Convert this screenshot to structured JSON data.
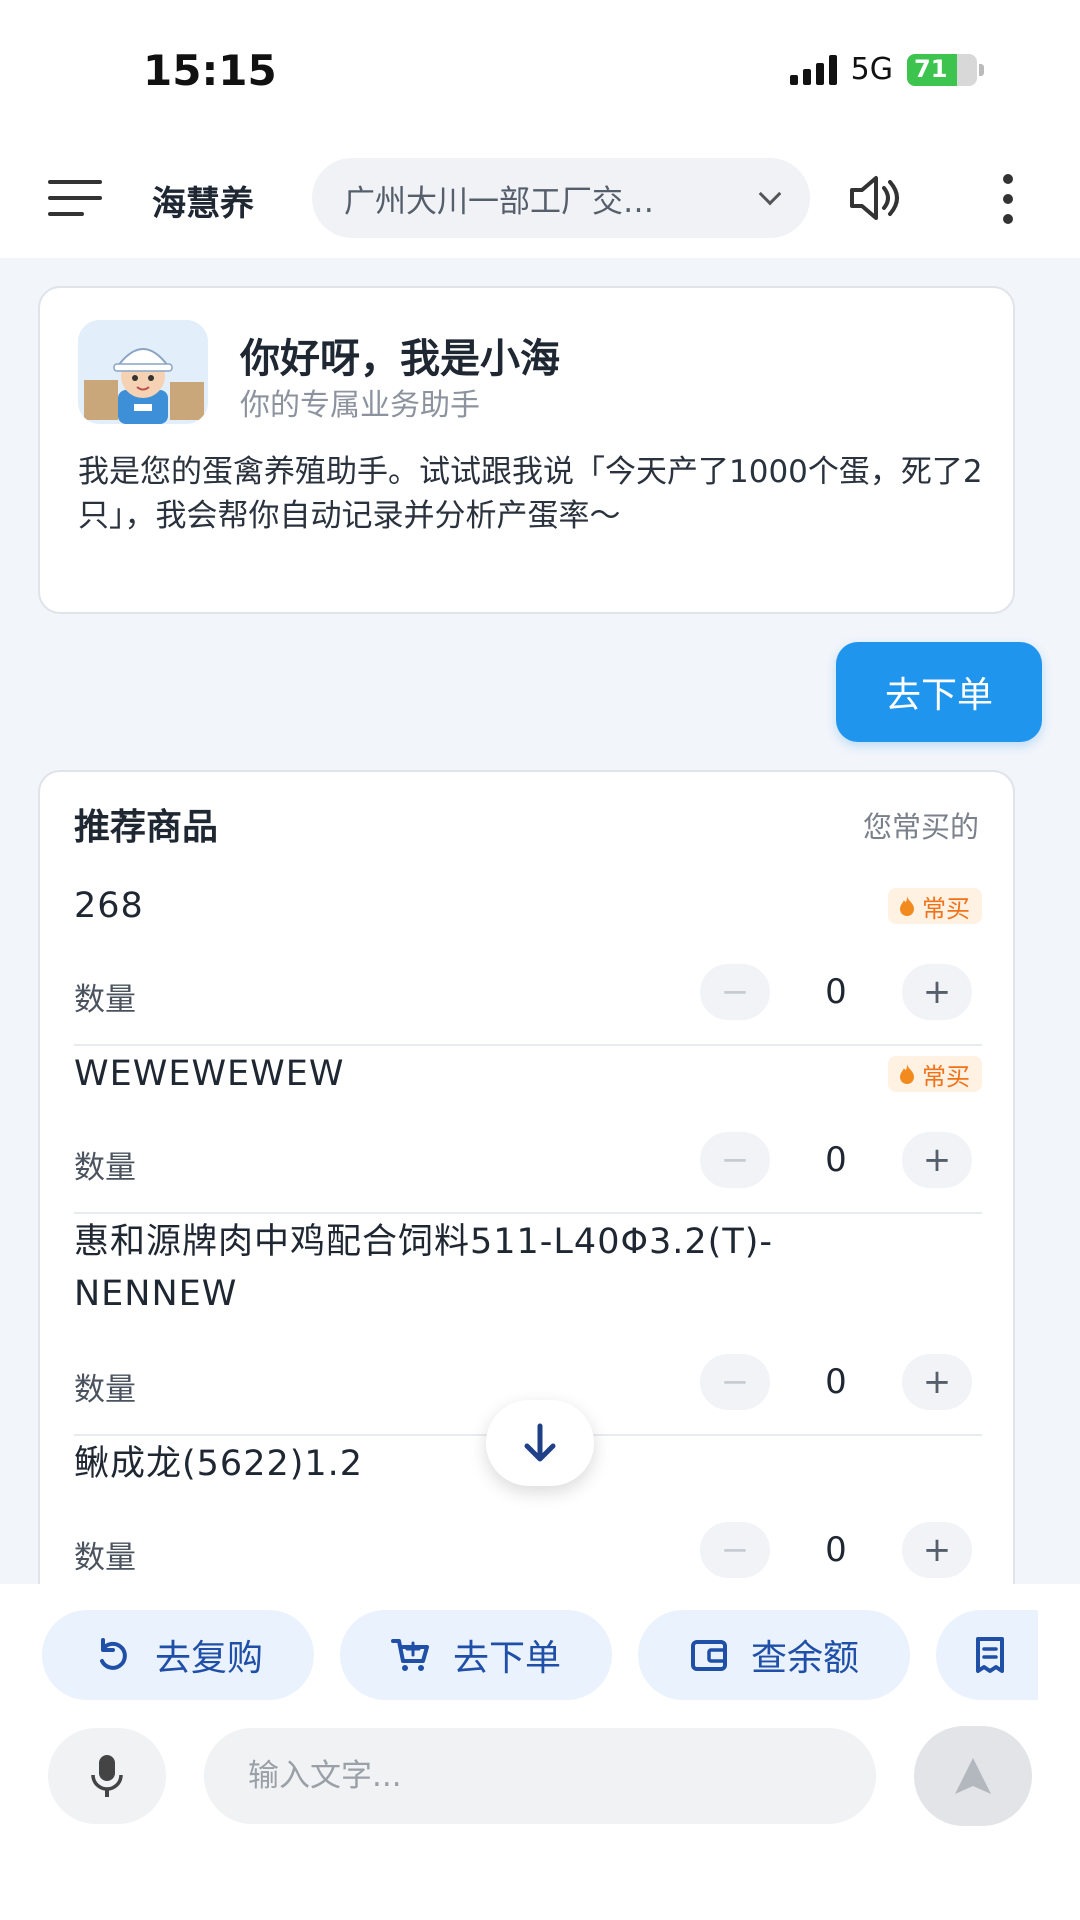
{
  "status_bar": {
    "time": "15:15",
    "network": "5G",
    "battery": "71",
    "battery_level": 0.71
  },
  "header": {
    "title": "海慧养",
    "farm_selector": "广州大川一部工厂交…",
    "icons": {
      "menu": "menu-icon",
      "speaker": "speaker-icon",
      "more": "more-vertical-icon",
      "dropdown": "chevron-down-icon"
    }
  },
  "greeting": {
    "title": "你好呀，我是小海",
    "subtitle": "你的专属业务助手",
    "body": "我是您的蛋禽养殖助手。试试跟我说「今天产了1000个蛋，死了2只」，我会帮你自动记录并分析产蛋率～",
    "avatar": "ai-assistant-avatar"
  },
  "user_message": "去下单",
  "recommend": {
    "title": "推荐商品",
    "hint": "您常买的",
    "qty_label": "数量",
    "minus": "−",
    "plus": "+",
    "products": [
      {
        "name": "268",
        "badge": "常买",
        "qty": "0"
      },
      {
        "name": "WEWEWEWEW",
        "badge": "常买",
        "qty": "0"
      },
      {
        "name": "惠和源牌肉中鸡配合饲料511-L40Φ3.2(T)-NENNEW",
        "badge": "",
        "qty": "0"
      },
      {
        "name": "鳅成龙(5622)1.2",
        "badge": "",
        "qty": "0"
      }
    ]
  },
  "quick_actions": [
    {
      "label": "去复购",
      "icon": "refresh-icon"
    },
    {
      "label": "去下单",
      "icon": "cart-icon"
    },
    {
      "label": "查余额",
      "icon": "wallet-icon"
    },
    {
      "label": "",
      "icon": "receipt-icon"
    }
  ],
  "input": {
    "placeholder": "输入文字..."
  },
  "colors": {
    "accent": "#1f95ee",
    "chip_bg": "#eaf2fd",
    "chip_text": "#1f4fa6",
    "badge": "#f0731a"
  }
}
